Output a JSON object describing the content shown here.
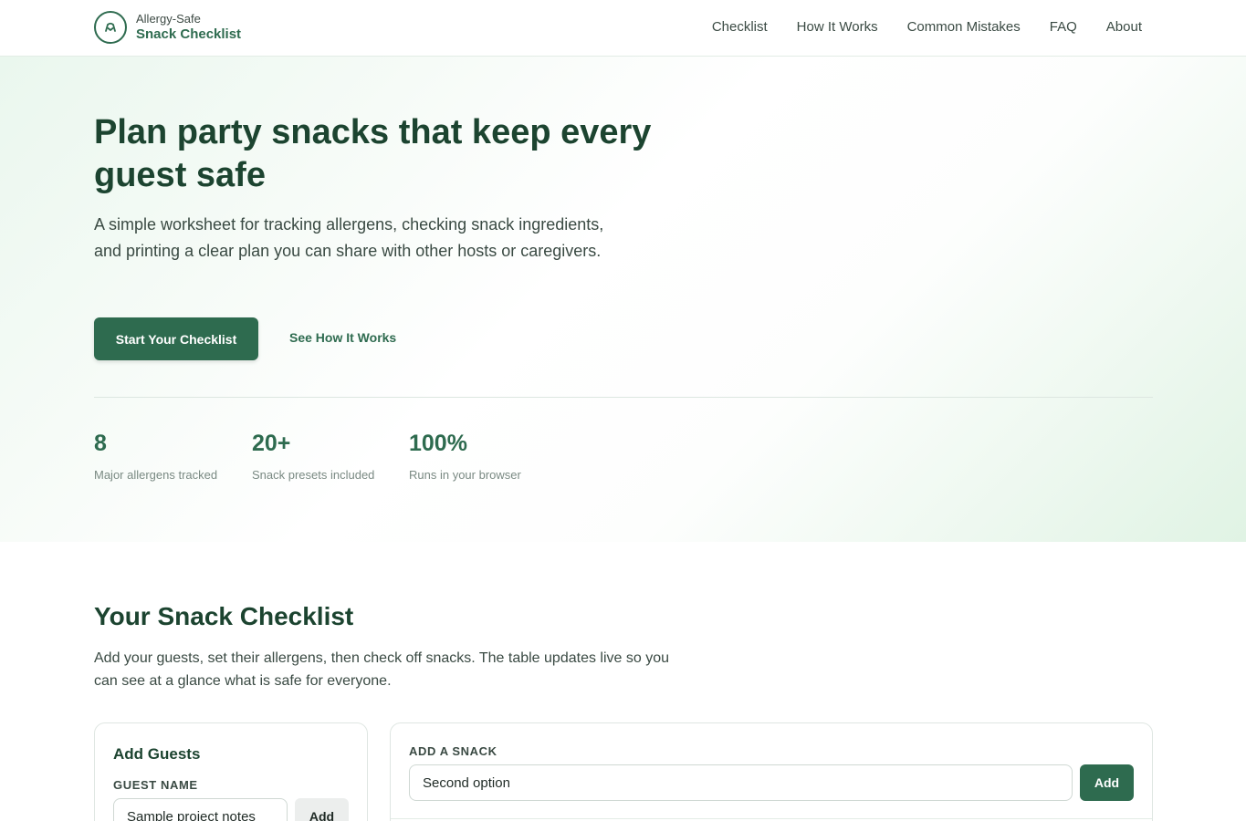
{
  "header": {
    "brand_top": "Allergy-Safe",
    "brand_bottom": "Snack Checklist",
    "logo_icon": "allergy-shield-icon",
    "nav": [
      "Checklist",
      "How It Works",
      "Common Mistakes",
      "FAQ",
      "About"
    ]
  },
  "hero": {
    "title": "Plan party snacks that keep every guest safe",
    "description": "A simple worksheet for tracking allergens, checking snack ingredients, and printing a clear plan you can share with other hosts or caregivers.",
    "primary_cta": "Start Your Checklist",
    "secondary_cta": "See How It Works",
    "stats": [
      {
        "value": "8",
        "label": "Major allergens tracked"
      },
      {
        "value": "20+",
        "label": "Snack presets included"
      },
      {
        "value": "100%",
        "label": "Runs in your browser"
      }
    ]
  },
  "checklist": {
    "title": "Your Snack Checklist",
    "description": "Add your guests, set their allergens, then check off snacks. The table updates live so you can see at a glance what is safe for everyone.",
    "guests_card": {
      "heading": "Add Guests",
      "field_label": "GUEST NAME",
      "input_value": "Sample project notes",
      "add_label": "Add"
    },
    "snack_card": {
      "field_label": "ADD A SNACK",
      "input_value": "Second option",
      "add_label": "Add"
    }
  },
  "colors": {
    "brand_green": "#2e6b4f",
    "heading_green": "#1c4430",
    "text_gray": "#3a4a43"
  }
}
